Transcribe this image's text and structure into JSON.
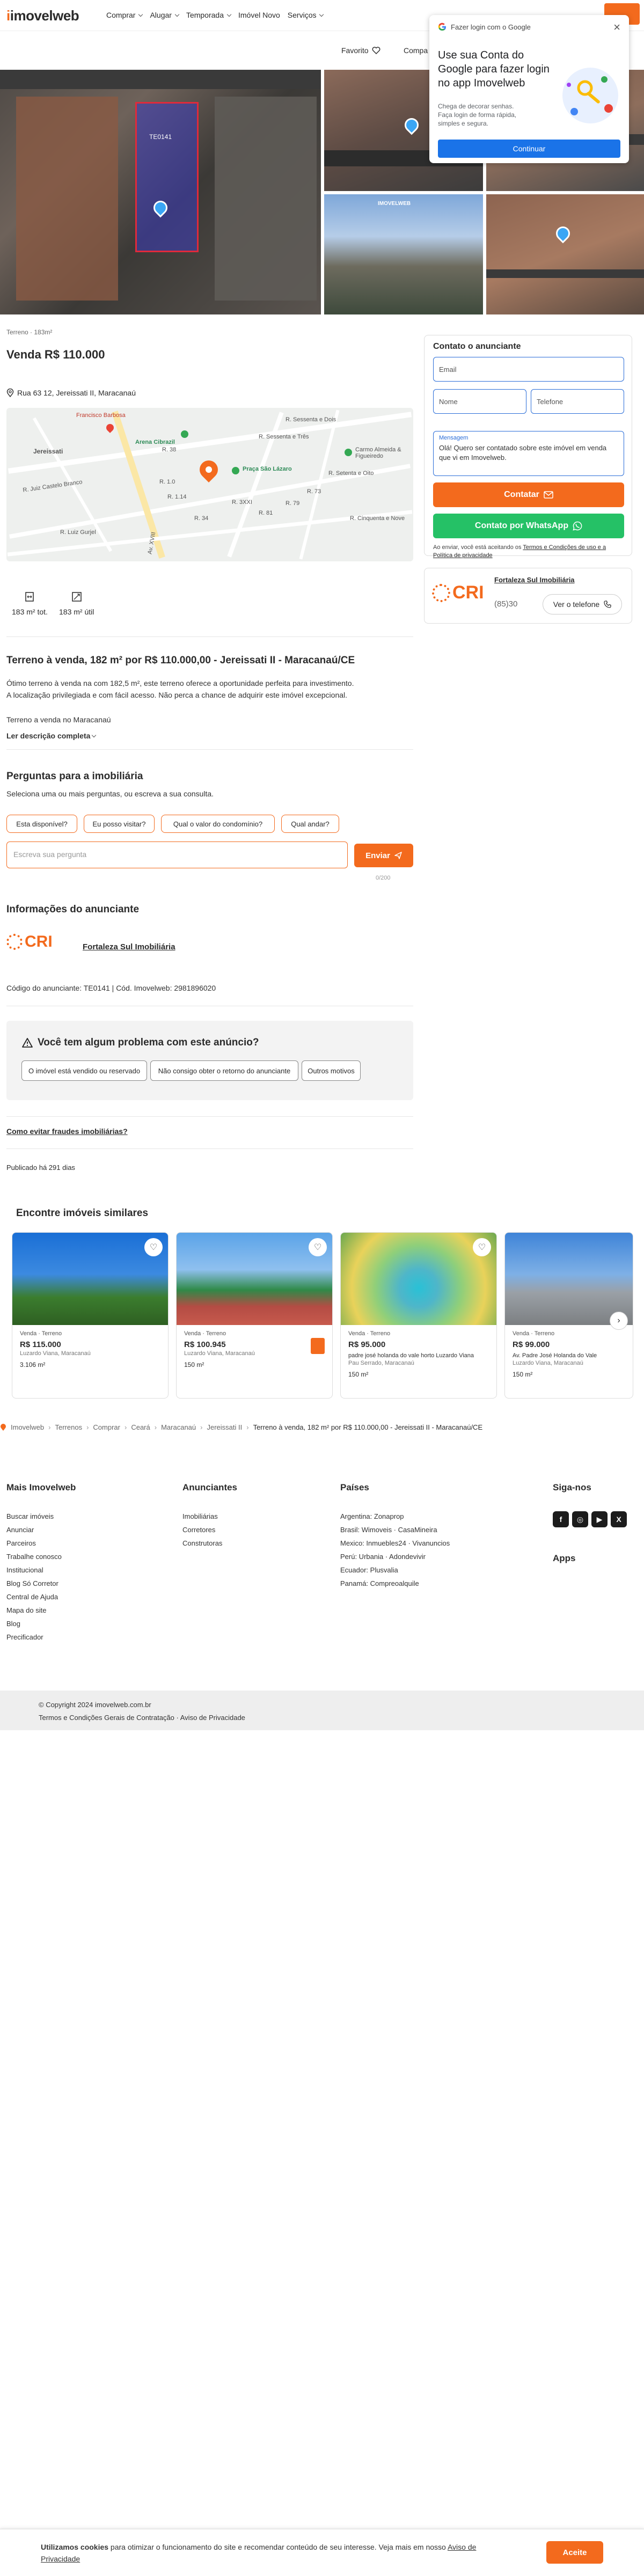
{
  "header": {
    "logo": "imovelweb",
    "nav": [
      "Comprar",
      "Alugar",
      "Temporada",
      "Imóvel Novo",
      "Serviços"
    ],
    "favorites": "Favorito",
    "compare": "Compa"
  },
  "google_popup": {
    "header": "Fazer login com o Google",
    "title": "Use sua Conta do Google para fazer login no app Imovelweb",
    "text": "Chega de decorar senhas. Faça login de forma rápida, simples e segura.",
    "button": "Continuar"
  },
  "gallery": {
    "lot_label": "TE0141",
    "photo_sign": "IMOVELWEB"
  },
  "listing": {
    "type_area": "Terreno · 183m²",
    "price_title": "Venda R$ 110.000",
    "address": "Rua 63 12, Jereissati II, Maracanaú",
    "features": [
      {
        "icon": "width-icon",
        "label": "183 m² tot."
      },
      {
        "icon": "area-icon",
        "label": "183 m² útil"
      }
    ],
    "desc_title": "Terreno à venda, 182 m² por R$ 110.000,00 - Jereissati II - Maracanaú/CE",
    "desc_p1": "Ótimo terreno à venda na com 182,5 m², este terreno oferece a oportunidade perfeita para investimento.",
    "desc_p2": "A localização privilegiada e com fácil acesso. Não perca a chance de adquirir este imóvel excepcional.",
    "desc_p3": "Terreno a venda no Maracanaú",
    "read_more": "Ler descrição completa"
  },
  "map": {
    "labels": [
      "Jereissati",
      "Francisco Barbosa",
      "Arena Cibrazil",
      "Praça São Lázaro",
      "Carmo Almeida & Figueiredo",
      "R. 1.0",
      "R. 1.14",
      "R. 38",
      "R. 34",
      "R. 3XXI",
      "R. 81",
      "R. 79",
      "R. 73",
      "R. Juiz Castelo Branco",
      "R. Luiz Gurjel",
      "R. Sessenta e Três",
      "R. Sessenta e Dois",
      "R. Setenta e Oito",
      "Av. XVIII",
      "R. Cinquenta e Nove"
    ]
  },
  "questions": {
    "title": "Perguntas para a imobiliária",
    "subtitle": "Seleciona uma ou mais perguntas, ou escreva a sua consulta.",
    "chips": [
      "Esta disponível?",
      "Eu posso visitar?",
      "Qual o valor do condomínio?",
      "Qual andar?"
    ],
    "placeholder": "Escreva sua pergunta",
    "send": "Enviar",
    "counter": "0/200"
  },
  "advertiser": {
    "section_title": "Informações do anunciante",
    "name": "Fortaleza Sul Imobiliária",
    "logo_text": "CRI",
    "code": "Código do anunciante: TE0141 | Cód. Imovelweb: 2981896020"
  },
  "problem": {
    "title": "Você tem algum problema com este anúncio?",
    "chips": [
      "O imóvel está vendido ou reservado",
      "Não consigo obter o retorno do anunciante",
      "Outros motivos"
    ],
    "fraud_link": "Como evitar fraudes imobiliárias?",
    "published": "Publicado há 291 dias"
  },
  "contact": {
    "title": "Contato o anunciante",
    "email": "Email",
    "name": "Nome",
    "phone": "Telefone",
    "message_label": "Mensagem",
    "message": "Olá! Quero ser contatado sobre este imóvel em venda que vi em Imovelweb.",
    "submit": "Contatar",
    "whatsapp": "Contato por WhatsApp",
    "legal_1": "Ao enviar, você está aceitando os ",
    "legal_link": "Termos e Condições de uso e a Política de privacidade",
    "card_name": "Fortaleza Sul Imobiliária",
    "card_phone_masked": "(85)30",
    "see_phone": "Ver o telefone"
  },
  "similar": {
    "title": "Encontre imóveis similares",
    "cards": [
      {
        "type": "Venda · Terreno",
        "price": "R$ 115.000",
        "address": "",
        "city": "Luzardo Viana, Maracanaú",
        "area": "3.106 m²"
      },
      {
        "type": "Venda · Terreno",
        "price": "R$ 100.945",
        "address": "",
        "city": "Luzardo Viana, Maracanaú",
        "area": "150 m²"
      },
      {
        "type": "Venda · Terreno",
        "price": "R$ 95.000",
        "address": "padre josé holanda do vale horto Luzardo Viana",
        "city": "Pau Serrado, Maracanaú",
        "area": "150 m²"
      },
      {
        "type": "Venda · Terreno",
        "price": "R$ 99.000",
        "address": "Av. Padre José Holanda do Vale",
        "city": "Luzardo Viana, Maracanaú",
        "area": "150 m²"
      }
    ]
  },
  "breadcrumb": [
    "Imovelweb",
    "Terrenos",
    "Comprar",
    "Ceará",
    "Maracanaú",
    "Jereissati II",
    "Terreno à venda, 182 m² por R$ 110.000,00 - Jereissati II - Maracanaú/CE"
  ],
  "footer": {
    "col1_title": "Mais Imovelweb",
    "col1": [
      "Buscar imóveis",
      "Anunciar",
      "Parceiros",
      "Trabalhe conosco",
      "Institucional",
      "Blog Só Corretor",
      "Central de Ajuda",
      "Mapa do site",
      "Blog",
      "Precificador"
    ],
    "col2_title": "Anunciantes",
    "col2": [
      "Imobiliárias",
      "Corretores",
      "Construtoras"
    ],
    "col3_title": "Países",
    "col3": [
      "Argentina: Zonaprop",
      "Brasil: Wimoveis · CasaMineira",
      "Mexico: Inmuebles24 · Vivanuncios",
      "Perú: Urbania · Adondevivir",
      "Ecuador: Plusvalia",
      "Panamá: Compreoalquile"
    ],
    "col4_title": "Siga-nos",
    "apps_title": "Apps",
    "copyright": "© Copyright 2024 imovelweb.com.br",
    "terms": "Termos e Condições Gerais de Contratação · Aviso de Privacidade"
  },
  "cookie": {
    "bold": "Utilizamos cookies",
    "text": " para otimizar o funcionamento do site e recomendar conteúdo de seu interesse. Veja mais em nosso ",
    "link": "Aviso de Privacidade",
    "button": "Aceite"
  }
}
